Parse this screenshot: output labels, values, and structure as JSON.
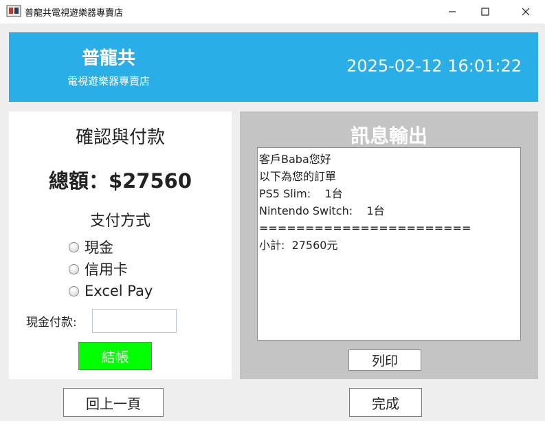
{
  "window": {
    "title": "普龍共電視遊樂器專賣店",
    "icon": "app-icon",
    "controls": [
      "minimize",
      "maximize",
      "close"
    ]
  },
  "header": {
    "brand_name": "普龍共",
    "brand_sub": "電視遊樂器專賣店",
    "datetime": "2025-02-12 16:01:22",
    "bg_color": "#29aee7"
  },
  "checkout": {
    "title": "確認與付款",
    "total_label": "總額：$27560",
    "payment_label": "支付方式",
    "payment_options": [
      "現金",
      "信用卡",
      "Excel Pay"
    ],
    "cash_label": "現金付款:",
    "cash_value": "",
    "checkout_button": "結帳",
    "checkout_color": "#00ff00"
  },
  "messages": {
    "title": "訊息輸出",
    "lines": [
      "客戶Baba您好",
      "以下為您的訂單",
      "PS5 Slim:    1台",
      "Nintendo Switch:    1台",
      "=======================",
      "小計:  27560元"
    ],
    "print_button": "列印"
  },
  "footer": {
    "back_button": "回上一頁",
    "done_button": "完成"
  }
}
